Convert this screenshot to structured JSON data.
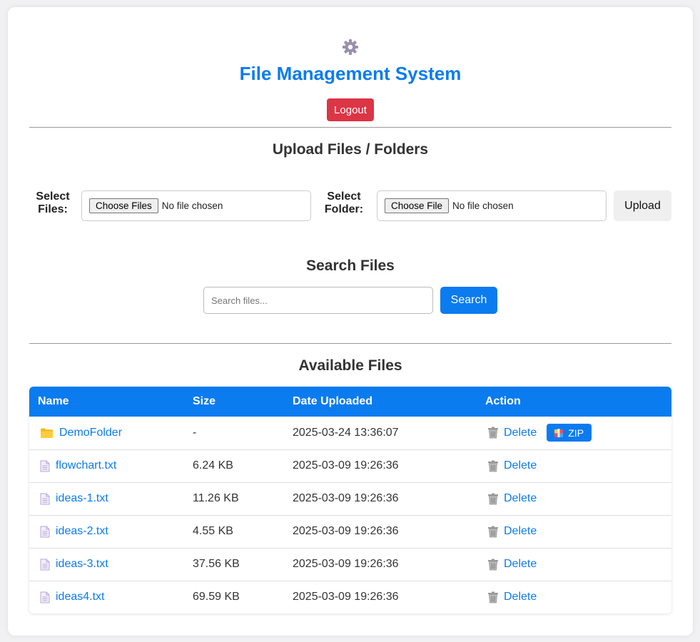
{
  "header": {
    "icon": "gear-icon",
    "title": "File Management System",
    "logout_label": "Logout"
  },
  "upload": {
    "section_title": "Upload Files / Folders",
    "files_label": "Select Files:",
    "files_button": "Choose Files",
    "files_status": "No file chosen",
    "folder_label": "Select Folder:",
    "folder_button": "Choose File",
    "folder_status": "No file chosen",
    "upload_label": "Upload"
  },
  "search": {
    "section_title": "Search Files",
    "placeholder": "Search files...",
    "value": "",
    "button_label": "Search"
  },
  "files": {
    "section_title": "Available Files",
    "columns": [
      "Name",
      "Size",
      "Date Uploaded",
      "Action"
    ],
    "delete_label": "Delete",
    "zip_label": "ZIP",
    "rows": [
      {
        "icon": "folder-icon",
        "name": "DemoFolder",
        "size": "-",
        "date": "2025-03-24 13:36:07",
        "zip": true
      },
      {
        "icon": "file-icon",
        "name": "flowchart.txt",
        "size": "6.24 KB",
        "date": "2025-03-09 19:26:36",
        "zip": false
      },
      {
        "icon": "file-icon",
        "name": "ideas-1.txt",
        "size": "11.26 KB",
        "date": "2025-03-09 19:26:36",
        "zip": false
      },
      {
        "icon": "file-icon",
        "name": "ideas-2.txt",
        "size": "4.55 KB",
        "date": "2025-03-09 19:26:36",
        "zip": false
      },
      {
        "icon": "file-icon",
        "name": "ideas-3.txt",
        "size": "37.56 KB",
        "date": "2025-03-09 19:26:36",
        "zip": false
      },
      {
        "icon": "file-icon",
        "name": "ideas4.txt",
        "size": "69.59 KB",
        "date": "2025-03-09 19:26:36",
        "zip": false
      }
    ]
  },
  "colors": {
    "accent": "#0b7bf0",
    "danger": "#dc3545",
    "page_bg": "#f1f1f3"
  }
}
